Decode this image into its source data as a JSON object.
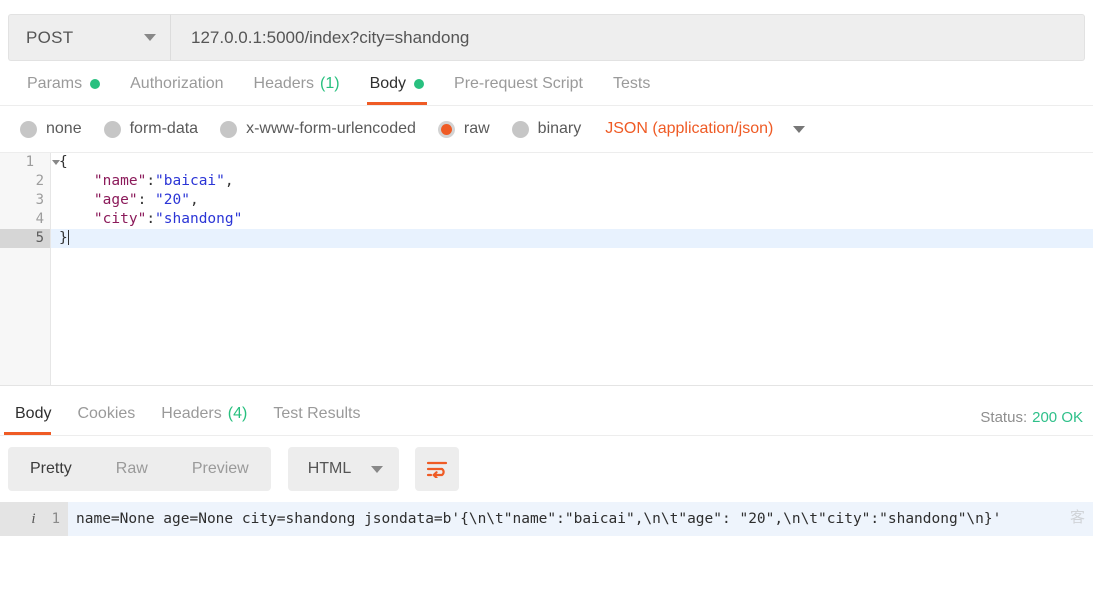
{
  "request": {
    "method": "POST",
    "url": "127.0.0.1:5000/index?city=shandong",
    "tabs": [
      {
        "label": "Params",
        "indicator": "dot",
        "active": false
      },
      {
        "label": "Authorization",
        "indicator": "none",
        "active": false
      },
      {
        "label": "Headers",
        "indicator": "count",
        "count": "(1)",
        "active": false
      },
      {
        "label": "Body",
        "indicator": "dot",
        "active": true
      },
      {
        "label": "Pre-request Script",
        "indicator": "none",
        "active": false
      },
      {
        "label": "Tests",
        "indicator": "none",
        "active": false
      }
    ],
    "body_types": [
      {
        "label": "none",
        "selected": false
      },
      {
        "label": "form-data",
        "selected": false
      },
      {
        "label": "x-www-form-urlencoded",
        "selected": false
      },
      {
        "label": "raw",
        "selected": true
      },
      {
        "label": "binary",
        "selected": false
      }
    ],
    "content_type": "JSON (application/json)",
    "editor": {
      "lines": [
        {
          "no": "1",
          "foldable": true,
          "active": false,
          "tokens": [
            {
              "t": "{",
              "c": "p"
            }
          ]
        },
        {
          "no": "2",
          "foldable": false,
          "active": false,
          "tokens": [
            {
              "t": "    \"name\"",
              "c": "k"
            },
            {
              "t": ":",
              "c": "p"
            },
            {
              "t": "\"baicai\"",
              "c": "v"
            },
            {
              "t": ",",
              "c": "p"
            }
          ]
        },
        {
          "no": "3",
          "foldable": false,
          "active": false,
          "tokens": [
            {
              "t": "    \"age\"",
              "c": "k"
            },
            {
              "t": ": ",
              "c": "p"
            },
            {
              "t": "\"20\"",
              "c": "v"
            },
            {
              "t": ",",
              "c": "p"
            }
          ]
        },
        {
          "no": "4",
          "foldable": false,
          "active": false,
          "tokens": [
            {
              "t": "    \"city\"",
              "c": "k"
            },
            {
              "t": ":",
              "c": "p"
            },
            {
              "t": "\"shandong\"",
              "c": "v"
            }
          ]
        },
        {
          "no": "5",
          "foldable": false,
          "active": true,
          "tokens": [
            {
              "t": "}",
              "c": "p"
            }
          ]
        }
      ]
    }
  },
  "response": {
    "tabs": [
      {
        "label": "Body",
        "indicator": "none",
        "active": true
      },
      {
        "label": "Cookies",
        "indicator": "none",
        "active": false
      },
      {
        "label": "Headers",
        "indicator": "count",
        "count": "(4)",
        "active": false
      },
      {
        "label": "Test Results",
        "indicator": "none",
        "active": false
      }
    ],
    "status_label": "Status:",
    "status_value": "200 OK",
    "view_modes": [
      {
        "label": "Pretty",
        "active": true
      },
      {
        "label": "Raw",
        "active": false
      },
      {
        "label": "Preview",
        "active": false
      }
    ],
    "format": "HTML",
    "line_number": "1",
    "body_text": "name=None age=None city=shandong jsondata=b'{\\n\\t\"name\":\"baicai\",\\n\\t\"age\": \"20\",\\n\\t\"city\":\"shandong\"\\n}'",
    "watermark": "客"
  },
  "colors": {
    "accent": "#ef5b25",
    "success": "#28c07f",
    "key": "#8b1a5a",
    "value": "#2b35d6"
  }
}
